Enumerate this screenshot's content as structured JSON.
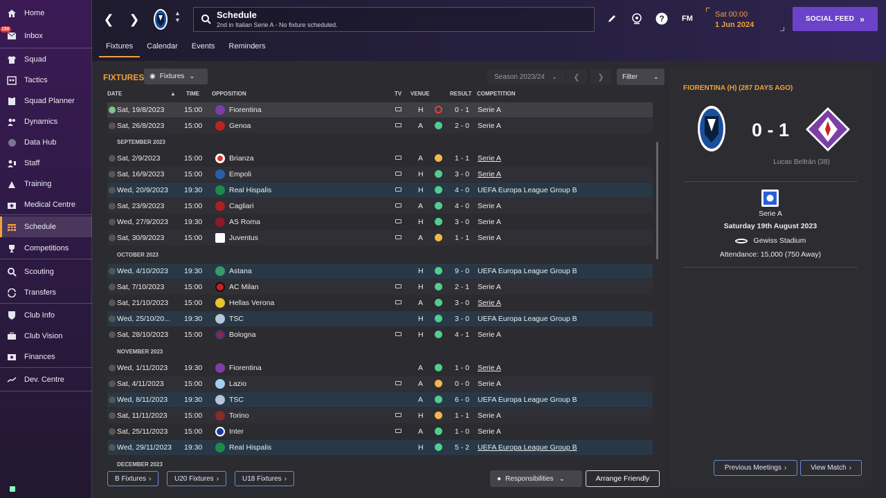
{
  "sidebar": {
    "inbox_badge": "150",
    "items": [
      {
        "label": "Home",
        "icon": "home-icon"
      },
      {
        "label": "Inbox",
        "icon": "inbox-icon"
      },
      {
        "label": "Squad",
        "icon": "shirt-icon"
      },
      {
        "label": "Tactics",
        "icon": "tactics-board-icon"
      },
      {
        "label": "Squad Planner",
        "icon": "clipboard-icon"
      },
      {
        "label": "Dynamics",
        "icon": "people-icon"
      },
      {
        "label": "Data Hub",
        "icon": "globe-icon"
      },
      {
        "label": "Staff",
        "icon": "staff-icon"
      },
      {
        "label": "Training",
        "icon": "training-icon"
      },
      {
        "label": "Medical Centre",
        "icon": "medical-icon"
      },
      {
        "label": "Schedule",
        "icon": "calendar-icon"
      },
      {
        "label": "Competitions",
        "icon": "trophy-icon"
      },
      {
        "label": "Scouting",
        "icon": "search-icon"
      },
      {
        "label": "Transfers",
        "icon": "transfer-icon"
      },
      {
        "label": "Club Info",
        "icon": "shield-icon"
      },
      {
        "label": "Club Vision",
        "icon": "briefcase-icon"
      },
      {
        "label": "Finances",
        "icon": "money-icon"
      },
      {
        "label": "Dev. Centre",
        "icon": "graph-icon"
      }
    ]
  },
  "header": {
    "title": "Schedule",
    "subtitle": "2nd in Italian Serie A - No fixture scheduled.",
    "date_line1": "Sat 00:00",
    "date_line2": "1 Jun 2024",
    "fm_label": "FM",
    "social_feed": "SOCIAL FEED"
  },
  "tabs": [
    "Fixtures",
    "Calendar",
    "Events",
    "Reminders"
  ],
  "fixtures": {
    "title": "FIXTURES",
    "view_dropdown": "Fixtures",
    "season": "Season 2023/24",
    "filter": "Filter",
    "columns": {
      "date": "DATE",
      "time": "TIME",
      "opposition": "OPPOSITION",
      "tv": "TV",
      "venue": "VENUE",
      "result": "RESULT",
      "competition": "COMPETITION"
    },
    "months": {
      "sep": "SEPTEMBER 2023",
      "oct": "OCTOBER 2023",
      "nov": "NOVEMBER 2023",
      "dec": "DECEMBER 2023"
    },
    "rows": [
      {
        "date": "Sat, 19/8/2023",
        "time": "15:00",
        "opp": "Fiorentina",
        "venue": "H",
        "result": "0 - 1",
        "comp": "Serie A"
      },
      {
        "date": "Sat, 26/8/2023",
        "time": "15:00",
        "opp": "Genoa",
        "venue": "A",
        "result": "2 - 0",
        "comp": "Serie A"
      },
      {
        "date": "Sat, 2/9/2023",
        "time": "15:00",
        "opp": "Brianza",
        "venue": "A",
        "result": "1 - 1",
        "comp": "Serie A"
      },
      {
        "date": "Sat, 16/9/2023",
        "time": "15:00",
        "opp": "Empoli",
        "venue": "H",
        "result": "3 - 0",
        "comp": "Serie A"
      },
      {
        "date": "Wed, 20/9/2023",
        "time": "19:30",
        "opp": "Real Hispalis",
        "venue": "H",
        "result": "4 - 0",
        "comp": "UEFA Europa League Group B"
      },
      {
        "date": "Sat, 23/9/2023",
        "time": "15:00",
        "opp": "Cagliari",
        "venue": "A",
        "result": "4 - 0",
        "comp": "Serie A"
      },
      {
        "date": "Wed, 27/9/2023",
        "time": "19:30",
        "opp": "AS Roma",
        "venue": "H",
        "result": "3 - 0",
        "comp": "Serie A"
      },
      {
        "date": "Sat, 30/9/2023",
        "time": "15:00",
        "opp": "Juventus",
        "venue": "A",
        "result": "1 - 1",
        "comp": "Serie A"
      },
      {
        "date": "Wed, 4/10/2023",
        "time": "19:30",
        "opp": "Astana",
        "venue": "H",
        "result": "9 - 0",
        "comp": "UEFA Europa League Group B"
      },
      {
        "date": "Sat, 7/10/2023",
        "time": "15:00",
        "opp": "AC Milan",
        "venue": "H",
        "result": "2 - 1",
        "comp": "Serie A"
      },
      {
        "date": "Sat, 21/10/2023",
        "time": "15:00",
        "opp": "Hellas Verona",
        "venue": "A",
        "result": "3 - 0",
        "comp": "Serie A"
      },
      {
        "date": "Wed, 25/10/20...",
        "time": "19:30",
        "opp": "TSC",
        "venue": "H",
        "result": "3 - 0",
        "comp": "UEFA Europa League Group B"
      },
      {
        "date": "Sat, 28/10/2023",
        "time": "15:00",
        "opp": "Bologna",
        "venue": "H",
        "result": "4 - 1",
        "comp": "Serie A"
      },
      {
        "date": "Wed, 1/11/2023",
        "time": "19:30",
        "opp": "Fiorentina",
        "venue": "A",
        "result": "1 - 0",
        "comp": "Serie A"
      },
      {
        "date": "Sat, 4/11/2023",
        "time": "15:00",
        "opp": "Lazio",
        "venue": "A",
        "result": "0 - 0",
        "comp": "Serie A"
      },
      {
        "date": "Wed, 8/11/2023",
        "time": "19:30",
        "opp": "TSC",
        "venue": "A",
        "result": "6 - 0",
        "comp": "UEFA Europa League Group B"
      },
      {
        "date": "Sat, 11/11/2023",
        "time": "15:00",
        "opp": "Torino",
        "venue": "H",
        "result": "1 - 1",
        "comp": "Serie A"
      },
      {
        "date": "Sat, 25/11/2023",
        "time": "15:00",
        "opp": "Inter",
        "venue": "A",
        "result": "1 - 0",
        "comp": "Serie A"
      },
      {
        "date": "Wed, 29/11/2023",
        "time": "19:30",
        "opp": "Real Hispalis",
        "venue": "H",
        "result": "5 - 2",
        "comp": "UEFA Europa League Group B"
      }
    ],
    "bottom_buttons": [
      "B Fixtures",
      "U20 Fixtures",
      "U18 Fixtures"
    ],
    "responsibilities": "Responsibilities",
    "arrange_friendly": "Arrange Friendly"
  },
  "match_panel": {
    "title": "FIORENTINA (H) (287 DAYS AGO)",
    "score": "0 - 1",
    "scorer": "Lucas Beltrán (38)",
    "competition": "Serie A",
    "date": "Saturday 19th August 2023",
    "stadium": "Gewiss Stadium",
    "attendance": "Attendance: 15,000 (750 Away)",
    "prev_meetings": "Previous Meetings",
    "view_match": "View Match"
  },
  "colors": {
    "accent": "#f2a23a",
    "win": "#4fcf8c",
    "draw": "#f2b84a",
    "loss": "#e2413c",
    "social": "#6a43c9"
  }
}
